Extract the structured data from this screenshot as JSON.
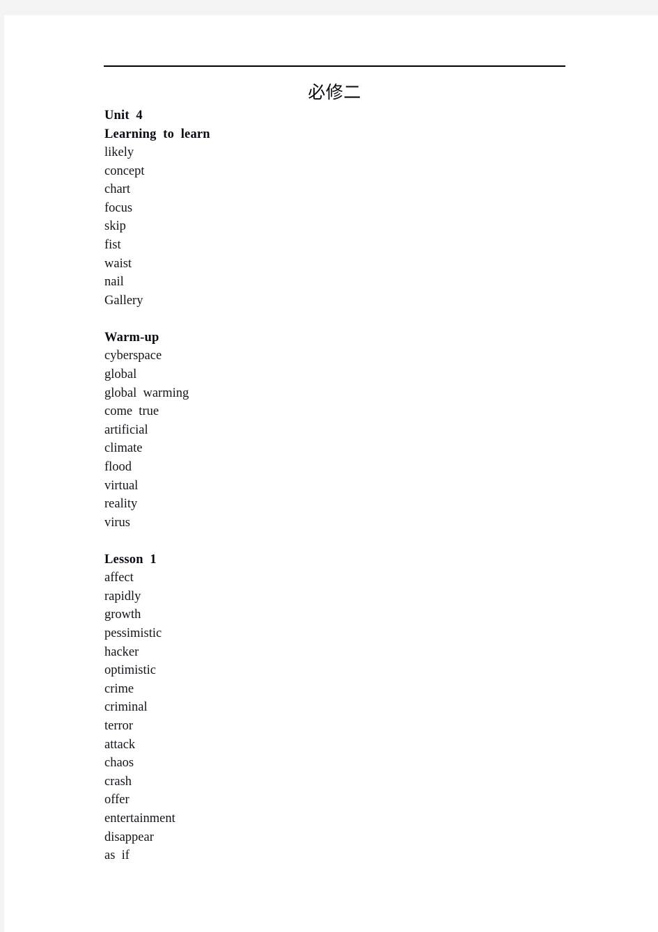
{
  "document": {
    "title": "必修二",
    "header_rule": true
  },
  "sections": [
    {
      "heading": "Unit  4",
      "subheading": "Learning  to  learn",
      "words": [
        "likely",
        "concept",
        "chart",
        "focus",
        "skip",
        "fist",
        "waist",
        "nail",
        "Gallery"
      ]
    },
    {
      "heading": "Warm-up",
      "subheading": null,
      "words": [
        "cyberspace",
        "global",
        "global  warming",
        "come  true",
        "artificial",
        "climate",
        "flood",
        "virtual",
        "reality",
        "virus"
      ]
    },
    {
      "heading": "Lesson  1",
      "subheading": null,
      "words": [
        "affect",
        "rapidly",
        "growth",
        "pessimistic",
        "hacker",
        "optimistic",
        "crime",
        "criminal",
        "terror",
        "attack",
        "chaos",
        "crash",
        "offer",
        "entertainment",
        "disappear",
        "as  if"
      ]
    }
  ],
  "colors": {
    "page_background": "#ffffff",
    "viewer_chrome": "#f4f4f4",
    "text": "#14141c",
    "rule": "#000000"
  }
}
